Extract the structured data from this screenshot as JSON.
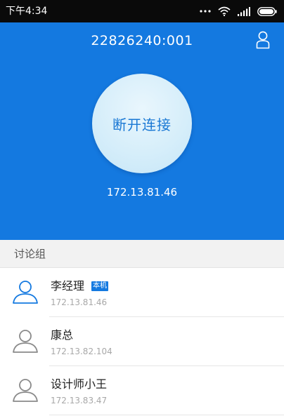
{
  "status_bar": {
    "time": "下午4:34",
    "icons": [
      "more-dots-icon",
      "wifi-icon",
      "signal-icon",
      "battery-icon"
    ]
  },
  "header": {
    "title": "22826240:001",
    "connect_button_label": "断开连接",
    "ip": "172.13.81.46",
    "user_icon": "user-icon"
  },
  "section": {
    "title": "讨论组"
  },
  "members": [
    {
      "name": "李经理",
      "ip": "172.13.81.46",
      "badge": "本机",
      "avatar_color": "#1479e0"
    },
    {
      "name": "康总",
      "ip": "172.13.82.104",
      "badge": "",
      "avatar_color": "#8a8a8a"
    },
    {
      "name": "设计师小王",
      "ip": "172.13.83.47",
      "badge": "",
      "avatar_color": "#8a8a8a"
    }
  ],
  "colors": {
    "primary": "#1479e0",
    "status_bar": "#0a0a0a",
    "button_text": "#1a78d4"
  }
}
